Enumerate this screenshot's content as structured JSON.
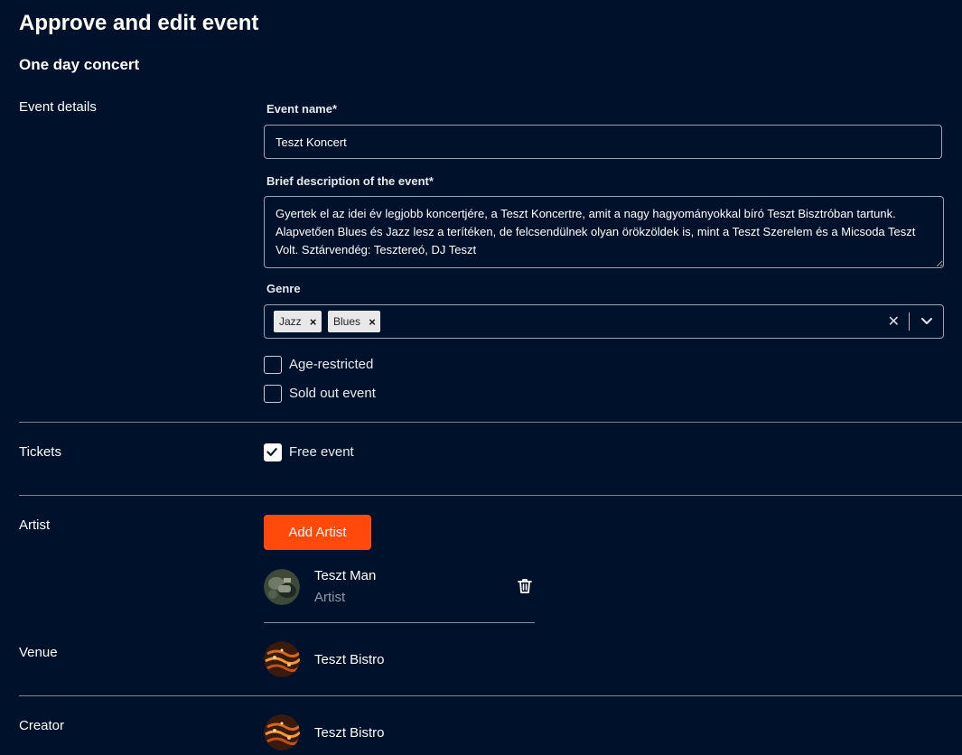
{
  "page": {
    "title": "Approve and edit event",
    "subtitle": "One day concert"
  },
  "event_details": {
    "section_label": "Event details",
    "event_name_label": "Event name*",
    "event_name_value": "Teszt Koncert",
    "description_label": "Brief description of the event*",
    "description_value": "Gyertek el az idei év legjobb koncertjére, a Teszt Koncertre, amit a nagy hagyományokkal bíró Teszt Bisztróban tartunk. Alapvetően Blues és Jazz lesz a terítéken, de felcsendülnek olyan örökzöldek is, mint a Teszt Szerelem és a Micsoda Teszt Volt. Sztárvendég: Tesztereó, DJ Teszt",
    "genre_label": "Genre",
    "genre_tags": [
      "Jazz",
      "Blues"
    ],
    "tag_remove_glyph": "×",
    "clear_glyph": "✕",
    "age_restricted_label": "Age-restricted",
    "age_restricted_checked": false,
    "sold_out_label": "Sold out event",
    "sold_out_checked": false
  },
  "tickets": {
    "section_label": "Tickets",
    "free_event_label": "Free event",
    "free_event_checked": true
  },
  "artist": {
    "section_label": "Artist",
    "add_button_label": "Add Artist",
    "items": [
      {
        "name": "Teszt Man",
        "role": "Artist",
        "remove_icon": "trash-icon"
      }
    ]
  },
  "venue": {
    "section_label": "Venue",
    "name": "Teszt Bistro"
  },
  "creator": {
    "section_label": "Creator",
    "name": "Teszt Bistro"
  },
  "colors": {
    "background": "#00112b",
    "accent": "#ff4a0b",
    "border": "#9aa3b1",
    "muted_text": "#9099a8"
  }
}
